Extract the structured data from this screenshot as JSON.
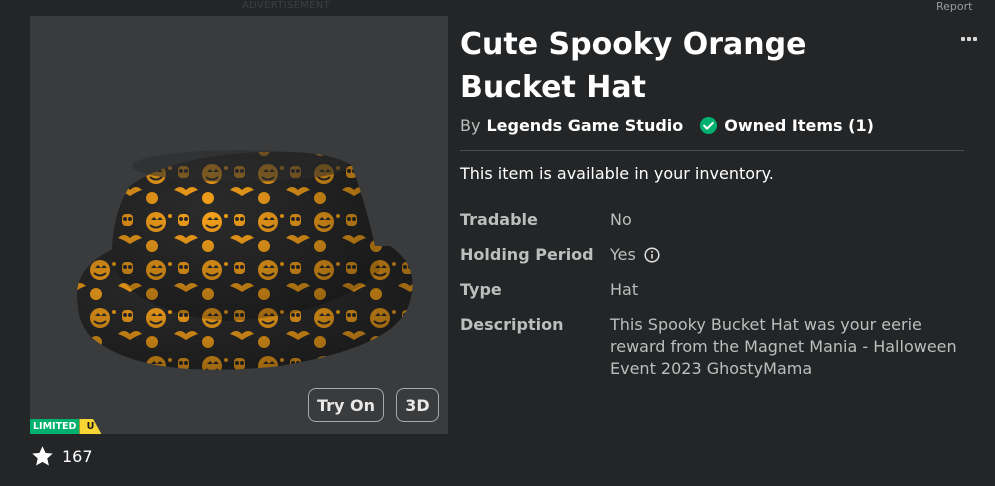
{
  "top": {
    "advertisement": "ADVERTISEMENT",
    "report": "Report"
  },
  "item": {
    "title": "Cute Spooky Orange Bucket Hat",
    "by_label": "By",
    "creator": "Legends Game Studio",
    "owned_label": "Owned Items (1)",
    "availability": "This item is available in your inventory.",
    "details": {
      "tradable_label": "Tradable",
      "tradable_value": "No",
      "holding_label": "Holding Period",
      "holding_value": "Yes",
      "type_label": "Type",
      "type_value": "Hat",
      "description_label": "Description",
      "description_value": "This Spooky Bucket Hat was your eerie reward from the Magnet Mania - Halloween Event 2023 GhostyMama"
    }
  },
  "thumbnail": {
    "try_on_label": "Try On",
    "view_3d_label": "3D",
    "limited_label": "LIMITED",
    "limited_u_label": "U"
  },
  "favorites": {
    "count": "167",
    "icon": "star-icon"
  },
  "icons": {
    "more": "more-options-icon",
    "owned": "check-circle-icon",
    "info": "info-icon"
  },
  "colors": {
    "background": "#232527",
    "thumb_bg": "#393b3d",
    "owned_check": "#00b06f",
    "limited_green": "#00b06f",
    "limited_yellow": "#f6d433",
    "hat_orange": "#f7a21b",
    "hat_dark": "#2b2b2b"
  }
}
